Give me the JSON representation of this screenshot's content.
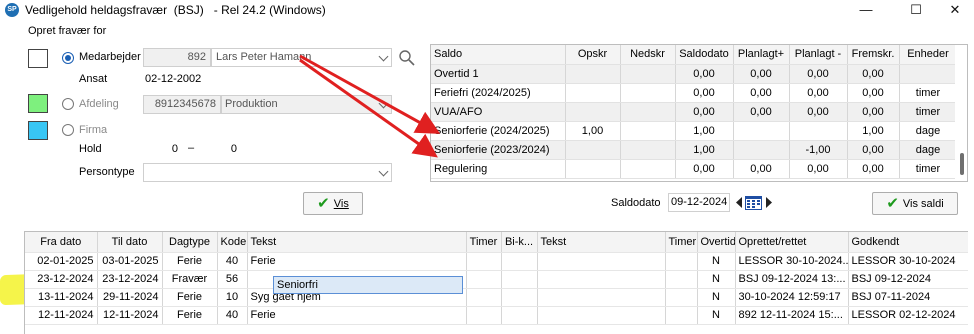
{
  "window": {
    "title": "Vedligehold heldagsfravær  (BSJ)   - Rel 24.2 (Windows)",
    "logo": "SP",
    "controls": [
      "—",
      "☐",
      "✕"
    ]
  },
  "group_label": "Opret fravær for",
  "selector": {
    "medarbejder_label": "Medarbejder",
    "medarbejder_code": "892",
    "medarbejder_name": "Lars Peter Hamann",
    "ansat_label": "Ansat",
    "ansat_value": "02-12-2002",
    "afdeling_label": "Afdeling",
    "afdeling_code": "8912345678",
    "afdeling_name": "Produktion",
    "firma_label": "Firma",
    "hold_label": "Hold",
    "hold_from": "0",
    "hold_dash": "–",
    "hold_to": "0",
    "persontype_label": "Persontype",
    "vis_label": "Vis"
  },
  "colors": {
    "swatch_medarbejder": "#ffffff",
    "swatch_afdeling": "#7ef07e",
    "swatch_firma": "#38c6f4",
    "highlight": "#f3f22a",
    "arrow": "#e02020"
  },
  "saldo": {
    "columns": [
      "Saldo",
      "Opskr",
      "Nedskr",
      "Saldodato",
      "Planlagt+",
      "Planlagt -",
      "Fremskr.",
      "Enheder"
    ],
    "rows": [
      [
        "Overtid 1",
        "",
        "",
        "0,00",
        "0,00",
        "0,00",
        "0,00",
        ""
      ],
      [
        "Feriefri (2024/2025)",
        "",
        "",
        "0,00",
        "0,00",
        "0,00",
        "0,00",
        "timer"
      ],
      [
        "VUA/AFO",
        "",
        "",
        "0,00",
        "0,00",
        "0,00",
        "0,00",
        "timer"
      ],
      [
        "Seniorferie (2024/2025)",
        "1,00",
        "",
        "1,00",
        "",
        "",
        "1,00",
        "dage"
      ],
      [
        "Seniorferie (2023/2024)",
        "",
        "",
        "1,00",
        "",
        "-1,00",
        "0,00",
        "dage"
      ],
      [
        "Regulering",
        "",
        "",
        "0,00",
        "0,00",
        "0,00",
        "0,00",
        "timer"
      ]
    ],
    "saldodato_label": "Saldodato",
    "saldodato_value": "09-12-2024",
    "vis_saldi_label": "Vis saldi"
  },
  "grid": {
    "columns": [
      "Fra dato",
      "Til dato",
      "Dagtype",
      "Kode",
      "Tekst",
      "Timer",
      "Bi-k...",
      "Tekst",
      "Timer",
      "Overtid",
      "Oprettet/rettet",
      "Godkendt"
    ],
    "rows": [
      [
        "02-01-2025",
        "03-01-2025",
        "Ferie",
        "40",
        "Ferie",
        "",
        "",
        "",
        "",
        "N",
        "LESSOR 30-10-2024...",
        "LESSOR 30-10-2024"
      ],
      [
        "23-12-2024",
        "23-12-2024",
        "Fravær",
        "56",
        "Seniorfri",
        "",
        "",
        "",
        "",
        "N",
        "BSJ 09-12-2024 13:...",
        "BSJ 09-12-2024"
      ],
      [
        "13-11-2024",
        "29-11-2024",
        "Ferie",
        "10",
        "Syg gået hjem",
        "",
        "",
        "",
        "",
        "N",
        "30-10-2024 12:59:17",
        "BSJ 07-11-2024"
      ],
      [
        "12-11-2024",
        "12-11-2024",
        "Ferie",
        "40",
        "Ferie",
        "",
        "",
        "",
        "",
        "N",
        "892 12-11-2024 15:...",
        "LESSOR 02-12-2024"
      ]
    ]
  }
}
